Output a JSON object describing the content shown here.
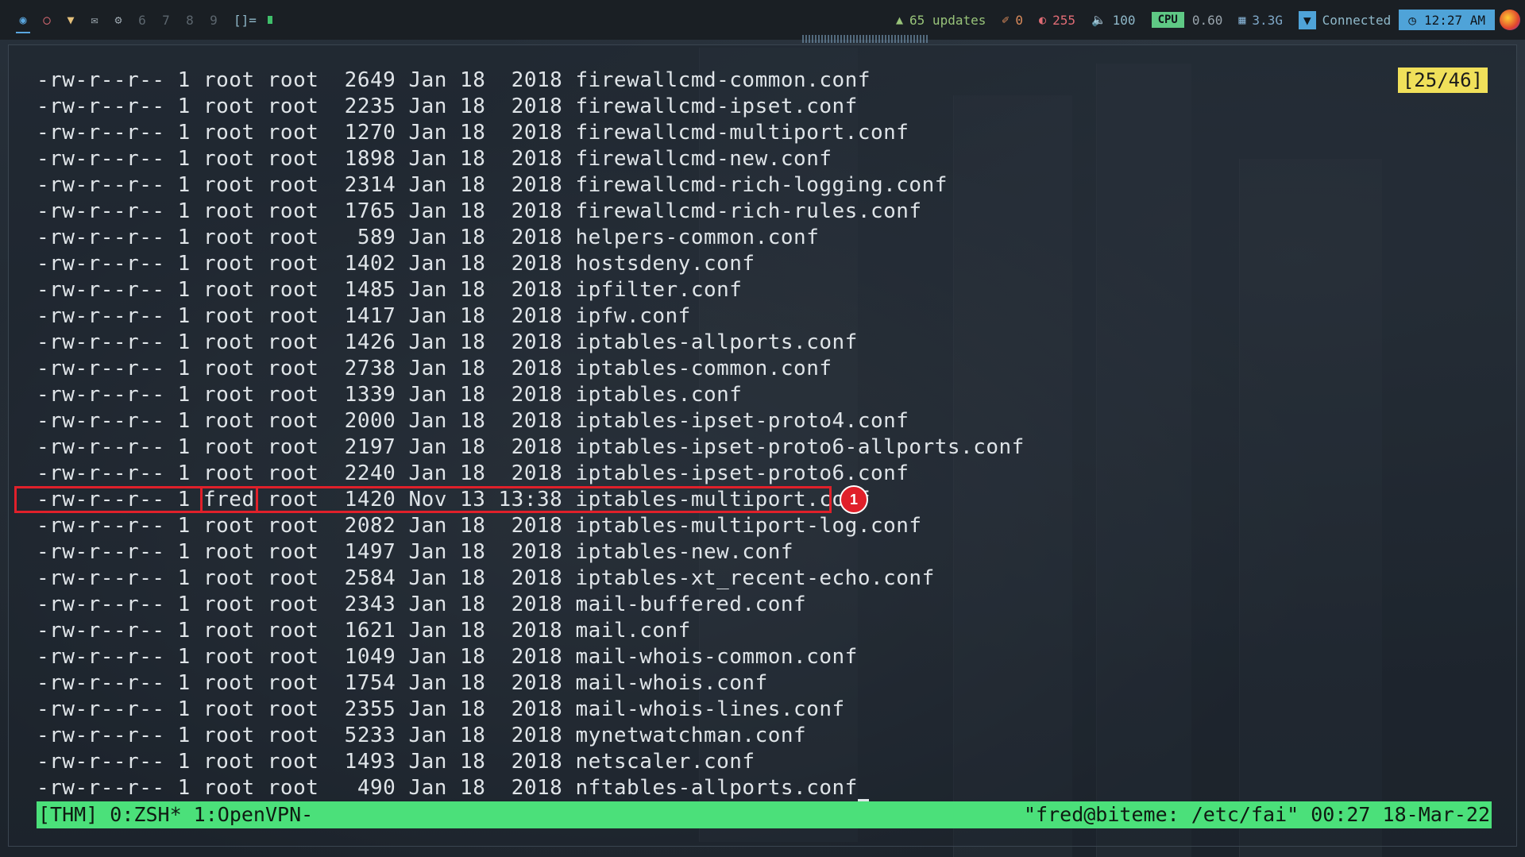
{
  "topbar": {
    "workspaces": [
      "6",
      "7",
      "8",
      "9"
    ],
    "layout_symbol": "[]=",
    "updates": "65 updates",
    "brightness_value": "0",
    "temp_value": "255",
    "volume_value": "100",
    "cpu_label": "CPU",
    "cpu_value": "0.60",
    "mem_value": "3.3G",
    "network_status": "Connected",
    "clock": "12:27 AM"
  },
  "terminal": {
    "pager_position": "[25/46]",
    "lines": [
      "-rw-r--r-- 1 root root  2649 Jan 18  2018 firewallcmd-common.conf",
      "-rw-r--r-- 1 root root  2235 Jan 18  2018 firewallcmd-ipset.conf",
      "-rw-r--r-- 1 root root  1270 Jan 18  2018 firewallcmd-multiport.conf",
      "-rw-r--r-- 1 root root  1898 Jan 18  2018 firewallcmd-new.conf",
      "-rw-r--r-- 1 root root  2314 Jan 18  2018 firewallcmd-rich-logging.conf",
      "-rw-r--r-- 1 root root  1765 Jan 18  2018 firewallcmd-rich-rules.conf",
      "-rw-r--r-- 1 root root   589 Jan 18  2018 helpers-common.conf",
      "-rw-r--r-- 1 root root  1402 Jan 18  2018 hostsdeny.conf",
      "-rw-r--r-- 1 root root  1485 Jan 18  2018 ipfilter.conf",
      "-rw-r--r-- 1 root root  1417 Jan 18  2018 ipfw.conf",
      "-rw-r--r-- 1 root root  1426 Jan 18  2018 iptables-allports.conf",
      "-rw-r--r-- 1 root root  2738 Jan 18  2018 iptables-common.conf",
      "-rw-r--r-- 1 root root  1339 Jan 18  2018 iptables.conf",
      "-rw-r--r-- 1 root root  2000 Jan 18  2018 iptables-ipset-proto4.conf",
      "-rw-r--r-- 1 root root  2197 Jan 18  2018 iptables-ipset-proto6-allports.conf",
      "-rw-r--r-- 1 root root  2240 Jan 18  2018 iptables-ipset-proto6.conf",
      "-rw-r--r-- 1 fred root  1420 Nov 13 13:38 iptables-multiport.conf",
      "-rw-r--r-- 1 root root  2082 Jan 18  2018 iptables-multiport-log.conf",
      "-rw-r--r-- 1 root root  1497 Jan 18  2018 iptables-new.conf",
      "-rw-r--r-- 1 root root  2584 Jan 18  2018 iptables-xt_recent-echo.conf",
      "-rw-r--r-- 1 root root  2343 Jan 18  2018 mail-buffered.conf",
      "-rw-r--r-- 1 root root  1621 Jan 18  2018 mail.conf",
      "-rw-r--r-- 1 root root  1049 Jan 18  2018 mail-whois-common.conf",
      "-rw-r--r-- 1 root root  1754 Jan 18  2018 mail-whois.conf",
      "-rw-r--r-- 1 root root  2355 Jan 18  2018 mail-whois-lines.conf",
      "-rw-r--r-- 1 root root  5233 Jan 18  2018 mynetwatchman.conf",
      "-rw-r--r-- 1 root root  1493 Jan 18  2018 netscaler.conf",
      "-rw-r--r-- 1 root root   490 Jan 18  2018 nftables-allports.conf"
    ],
    "highlighted_line_index": 16,
    "annotation_marker": "1"
  },
  "tmux": {
    "left": "[THM] 0:ZSH* 1:OpenVPN-",
    "right": "\"fred@biteme: /etc/fai\" 00:27 18-Mar-22"
  },
  "colors": {
    "tmux_bar": "#4be07a",
    "highlight": "#e0202a",
    "pager_badge": "#f0e05a",
    "accent_blue": "#4fa3d8"
  }
}
